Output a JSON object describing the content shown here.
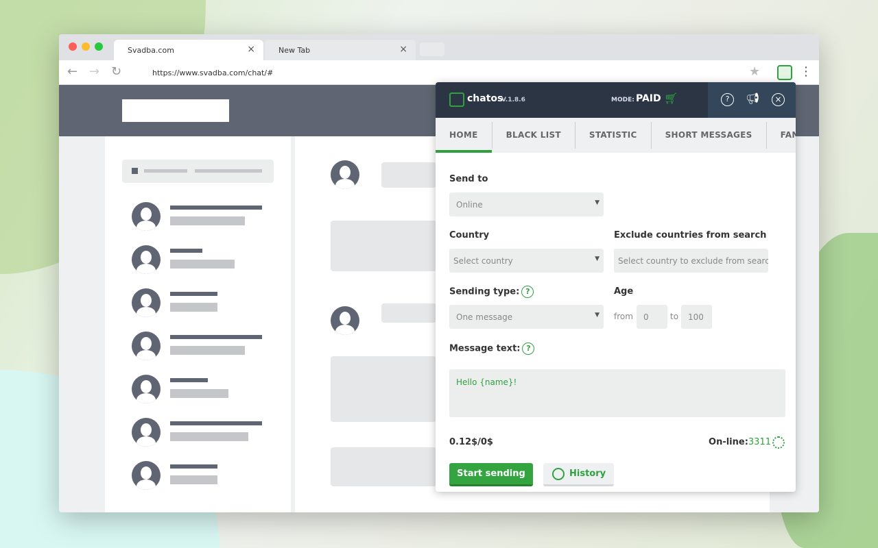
{
  "browser": {
    "tabs": [
      {
        "title": "Svadba.com"
      },
      {
        "title": "New Tab"
      }
    ],
    "url": "https://www.svadba.com/chat/#"
  },
  "popup": {
    "brand": "chatos",
    "version": "V.1.8.6",
    "mode_label": "MODE:",
    "mode_value": "PAID",
    "tabs": [
      "HOME",
      "BLACK LIST",
      "STATISTIC",
      "SHORT MESSAGES",
      "FANS"
    ],
    "send_to": {
      "label": "Send to",
      "value": "Online"
    },
    "country": {
      "label": "Country",
      "placeholder": "Select country"
    },
    "exclude": {
      "label": "Exclude countries from search",
      "placeholder": "Select country to exclude from search"
    },
    "sending_type": {
      "label": "Sending type:",
      "value": "One message"
    },
    "age": {
      "label": "Age",
      "from_label": "from",
      "from": "0",
      "to_label": "to",
      "to": "100"
    },
    "message": {
      "label": "Message text:",
      "value": "Hello {name}!"
    },
    "price": "0.12$/0$",
    "online_label": "On-line:",
    "online_count": "3311",
    "start_button": "Start sending",
    "history_button": "History",
    "colors": {
      "accent": "#33a43f",
      "header": "#2b3544"
    }
  }
}
